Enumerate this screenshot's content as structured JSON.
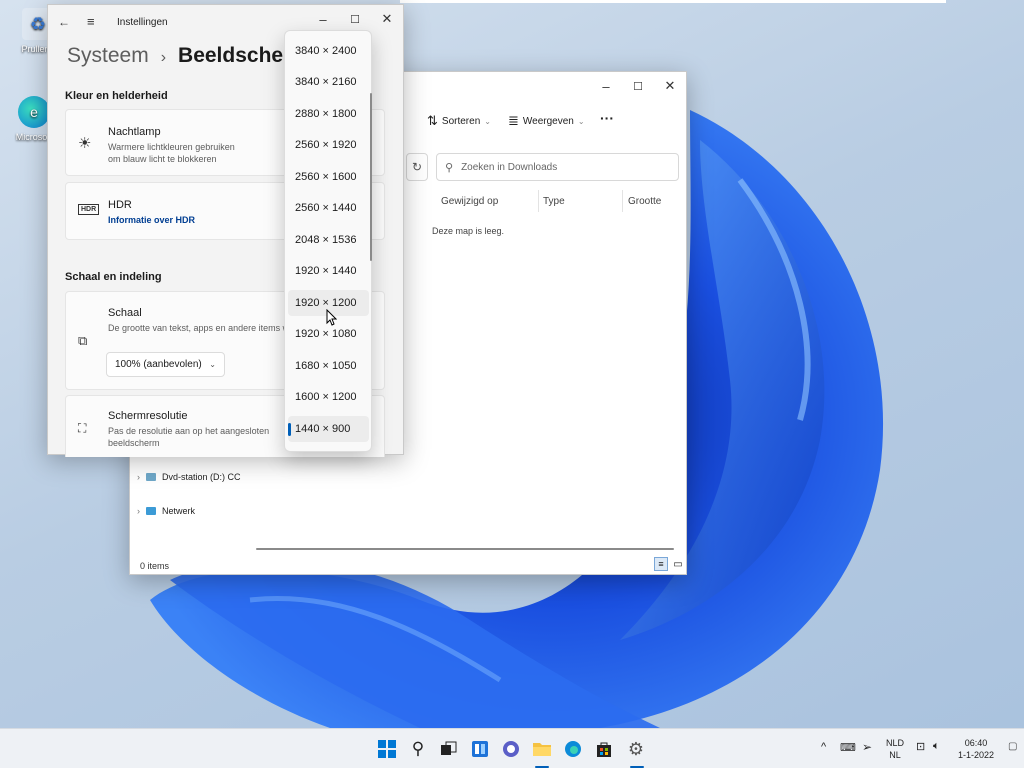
{
  "desktop": {
    "icons": [
      {
        "label": "Prullenb"
      },
      {
        "label": "Microsoft"
      }
    ]
  },
  "settings": {
    "app_title": "Instellingen",
    "breadcrumb_parent": "Systeem",
    "breadcrumb_sep": "›",
    "page_title": "Beeldscherm",
    "section_color": "Kleur en helderheid",
    "nightlight": {
      "title": "Nachtlamp",
      "subtitle_1": "Warmere lichtkleuren gebruiken",
      "subtitle_2": "om blauw licht te blokkeren"
    },
    "hdr": {
      "badge": "HDR",
      "title": "HDR",
      "link": "Informatie over HDR"
    },
    "section_scale": "Schaal en indeling",
    "scale": {
      "title": "Schaal",
      "subtitle": "De grootte van tekst, apps en andere items wi",
      "value": "100% (aanbevolen)"
    },
    "resolution": {
      "title": "Schermresolutie",
      "subtitle_1": "Pas de resolutie aan op het aangesloten",
      "subtitle_2": "beeldscherm"
    }
  },
  "resolution_dropdown": {
    "options": [
      "3840 × 2400",
      "3840 × 2160",
      "2880 × 1800",
      "2560 × 1920",
      "2560 × 1600",
      "2560 × 1440",
      "2048 × 1536",
      "1920 × 1440",
      "1920 × 1200",
      "1920 × 1080",
      "1680 × 1050",
      "1600 × 1200",
      "1440 × 900"
    ],
    "hovered": "1920 × 1200",
    "selected": "1440 × 900"
  },
  "explorer": {
    "sort_label": "Sorteren",
    "view_label": "Weergeven",
    "more_label": "···",
    "search_placeholder": "Zoeken in Downloads",
    "columns": [
      "Gewijzigd op",
      "Type",
      "Grootte"
    ],
    "empty_message": "Deze map is leeg.",
    "nav": [
      {
        "label": "Dvd-station (D:) CC"
      },
      {
        "label": "Netwerk"
      }
    ],
    "status": "0 items"
  },
  "taskbar": {
    "language_1": "NLD",
    "language_2": "NL",
    "time": "06:40",
    "date": "1-1-2022"
  },
  "colors": {
    "accent": "#005fb8",
    "link": "#003e92"
  }
}
